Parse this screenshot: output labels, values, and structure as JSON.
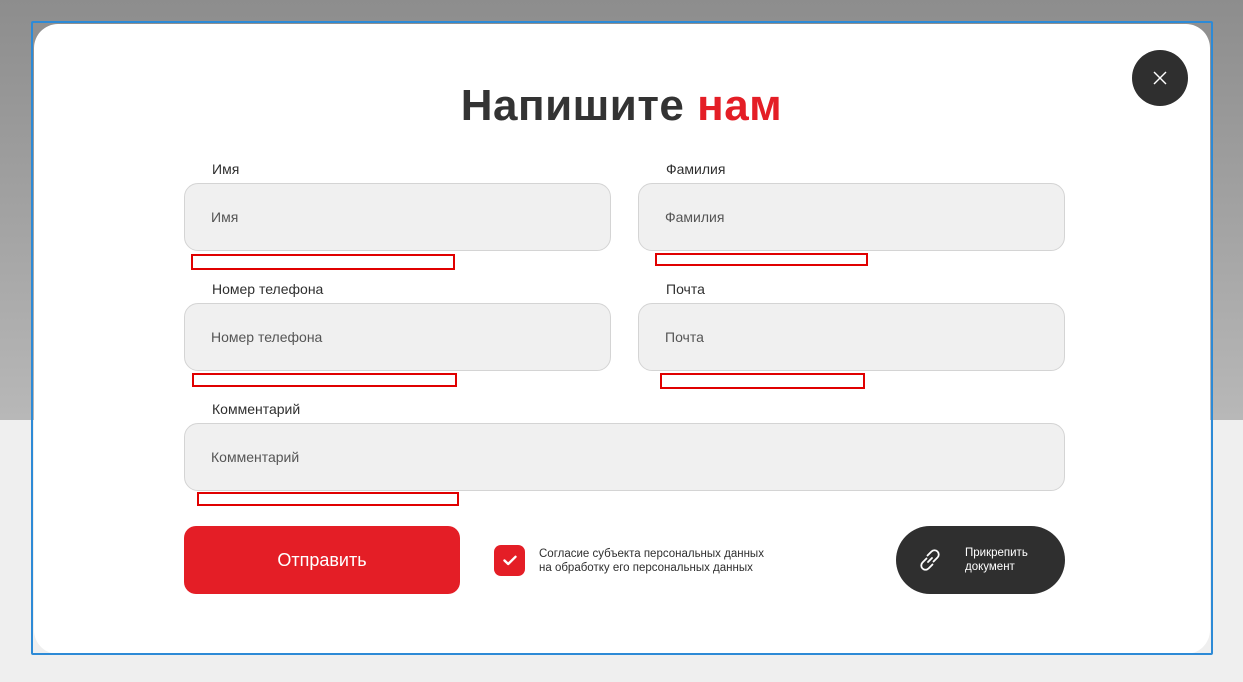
{
  "form": {
    "title": "Напишите",
    "title_accent": "нам",
    "fields": {
      "first_name": {
        "label": "Имя",
        "placeholder": "Имя"
      },
      "last_name": {
        "label": "Фамилия",
        "placeholder": "Фамилия"
      },
      "phone": {
        "label": "Номер телефона",
        "placeholder": "Номер телефона"
      },
      "email": {
        "label": "Почта",
        "placeholder": "Почта"
      },
      "comment": {
        "label": "Комментарий",
        "placeholder": "Комментарий"
      }
    },
    "submit_label": "Отправить",
    "consent": {
      "checked": true,
      "line1": "Согласие субъекта персональных данных",
      "line2": "на обработку его персональных данных"
    },
    "attach": {
      "line1": "Прикрепить",
      "line2": "документ"
    }
  },
  "colors": {
    "accent": "#e41e26",
    "dark": "#2f2f2f",
    "field_bg": "#f0f0f0",
    "selection_outline": "#2d8ad6",
    "error_outline": "#e00000"
  },
  "icons": {
    "close": "close-icon",
    "check": "check-icon",
    "attach": "paperclip-link-icon"
  }
}
